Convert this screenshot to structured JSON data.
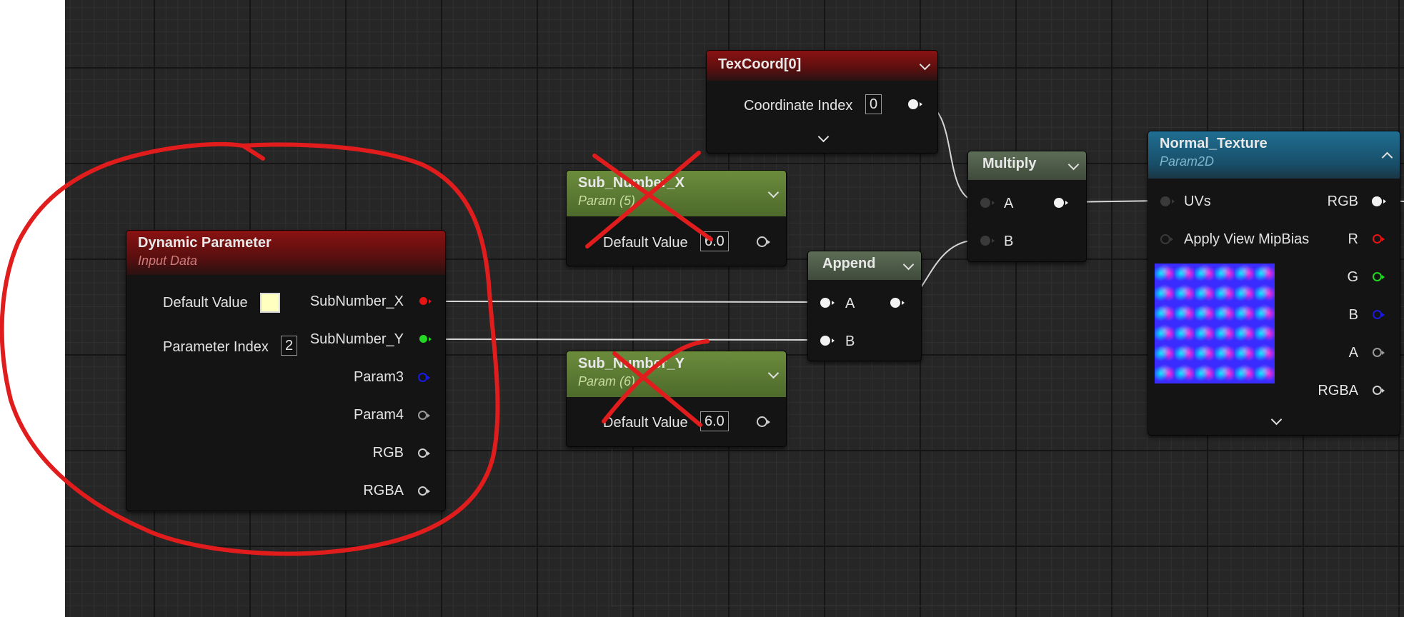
{
  "nodes": {
    "dynamic_parameter": {
      "title": "Dynamic Parameter",
      "subtitle": "Input Data",
      "default_value_label": "Default Value",
      "parameter_index_label": "Parameter Index",
      "parameter_index_value": "2",
      "default_color": "#ffffc0",
      "outputs": [
        {
          "label": "SubNumber_X",
          "color": "#e81414"
        },
        {
          "label": "SubNumber_Y",
          "color": "#22d822"
        },
        {
          "label": "Param3",
          "color": "#1a1ae0"
        },
        {
          "label": "Param4",
          "color": "#9a9a9a"
        },
        {
          "label": "RGB",
          "color": "#cfcfcf"
        },
        {
          "label": "RGBA",
          "color": "#cfcfcf"
        }
      ]
    },
    "texcoord": {
      "title": "TexCoord[0]",
      "coordinate_index_label": "Coordinate Index",
      "coordinate_index_value": "0"
    },
    "sub_number_x": {
      "title": "Sub_Number_X",
      "subtitle": "Param (5)",
      "default_value_label": "Default Value",
      "default_value": "6.0"
    },
    "sub_number_y": {
      "title": "Sub_Number_Y",
      "subtitle": "Param (6)",
      "default_value_label": "Default Value",
      "default_value": "6.0"
    },
    "multiply": {
      "title": "Multiply",
      "input_a": "A",
      "input_b": "B"
    },
    "append": {
      "title": "Append",
      "input_a": "A",
      "input_b": "B"
    },
    "normal_texture": {
      "title": "Normal_Texture",
      "subtitle": "Param2D",
      "inputs": [
        "UVs",
        "Apply View MipBias"
      ],
      "outputs": [
        {
          "label": "RGB",
          "color": "#cfcfcf"
        },
        {
          "label": "R",
          "color": "#e81414"
        },
        {
          "label": "G",
          "color": "#22d822"
        },
        {
          "label": "B",
          "color": "#1a1ae0"
        },
        {
          "label": "A",
          "color": "#9a9a9a"
        },
        {
          "label": "RGBA",
          "color": "#cfcfcf"
        }
      ]
    }
  },
  "annotation_color": "#e11c1c"
}
